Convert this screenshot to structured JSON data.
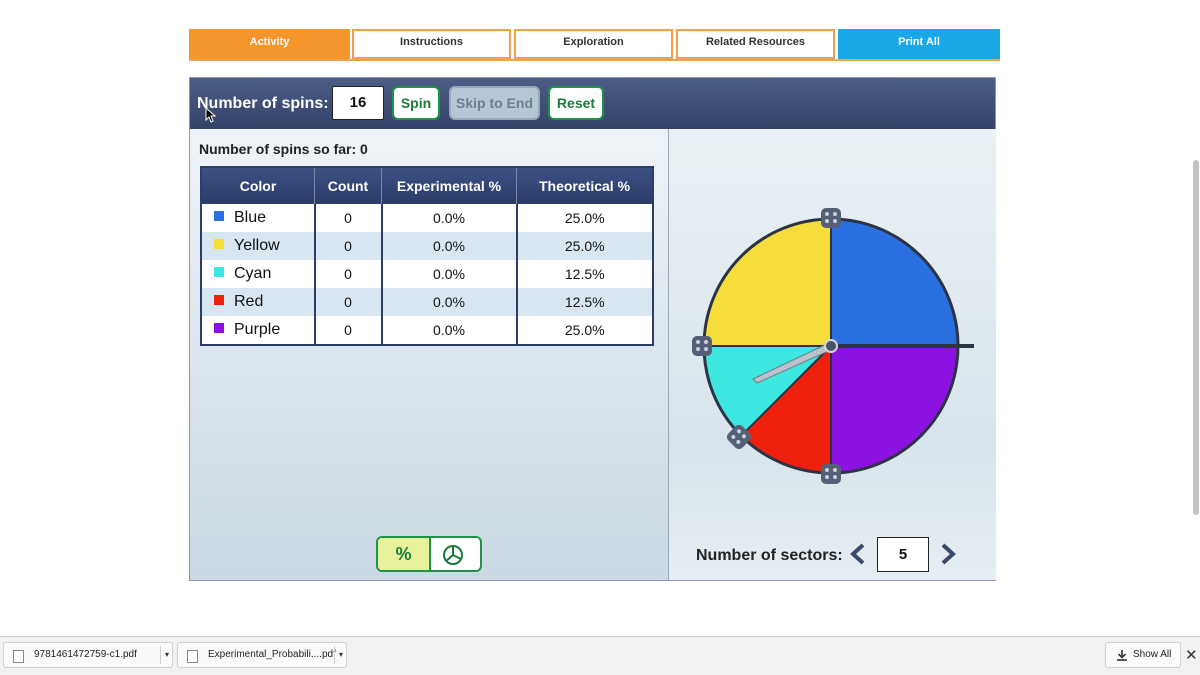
{
  "tabs": [
    {
      "label": "Activity",
      "active": true
    },
    {
      "label": "Instructions"
    },
    {
      "label": "Exploration"
    },
    {
      "label": "Related Resources"
    },
    {
      "label": "Print All"
    }
  ],
  "toolbar": {
    "spins_label": "Number of spins:",
    "spins_value": "16",
    "spin_label": "Spin",
    "skip_label": "Skip to End",
    "reset_label": "Reset"
  },
  "results": {
    "so_far_label": "Number of spins so far: 0",
    "headers": [
      "Color",
      "Count",
      "Experimental %",
      "Theoretical %"
    ],
    "rows": [
      {
        "color": "Blue",
        "swatch": "#2a6fe0",
        "count": "0",
        "experimental": "0.0%",
        "theoretical": "25.0%"
      },
      {
        "color": "Yellow",
        "swatch": "#f7dd3a",
        "count": "0",
        "experimental": "0.0%",
        "theoretical": "25.0%"
      },
      {
        "color": "Cyan",
        "swatch": "#3ee6e0",
        "count": "0",
        "experimental": "0.0%",
        "theoretical": "12.5%"
      },
      {
        "color": "Red",
        "swatch": "#f0200e",
        "count": "0",
        "experimental": "0.0%",
        "theoretical": "12.5%"
      },
      {
        "color": "Purple",
        "swatch": "#8b12e0",
        "count": "0",
        "experimental": "0.0%",
        "theoretical": "25.0%"
      }
    ]
  },
  "view_toggle": {
    "percent_label": "%",
    "pie_icon": "pie-chart-icon"
  },
  "spinner": {
    "sectors_label": "Number of sectors:",
    "sectors_value": "5",
    "sectors": [
      {
        "color": "#2a6fe0",
        "fraction": 0.25
      },
      {
        "color": "#8b12e0",
        "fraction": 0.25
      },
      {
        "color": "#f0200e",
        "fraction": 0.125
      },
      {
        "color": "#3ee6e0",
        "fraction": 0.125
      },
      {
        "color": "#f7dd3a",
        "fraction": 0.25
      }
    ]
  },
  "downloads": {
    "file1": "9781461472759-c1.pdf",
    "file2": "Experimental_Probabili....pdf",
    "show_all": "Show All"
  },
  "colors": {
    "accent_orange": "#f5962d",
    "accent_blue": "#1aa7e8",
    "toolbar_navy": "#3e4f7a",
    "button_green": "#1f9447"
  }
}
